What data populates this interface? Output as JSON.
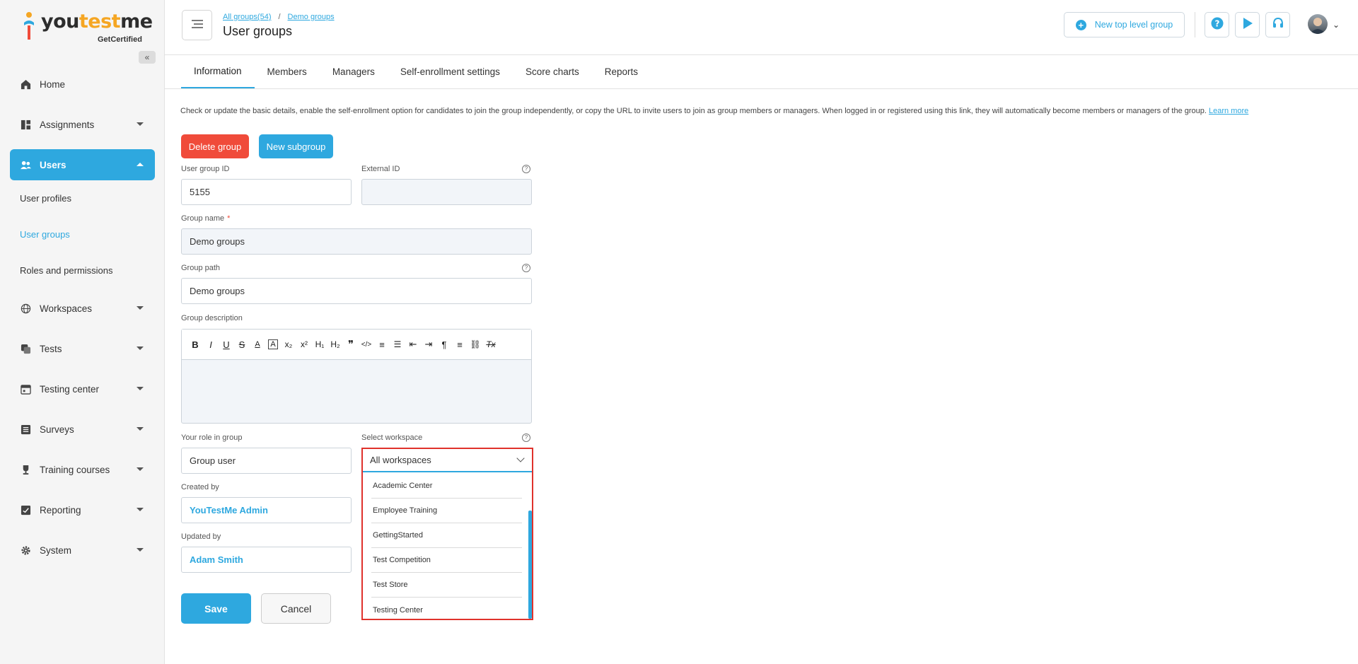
{
  "app": {
    "logo_you": "you",
    "logo_test": "test",
    "logo_me": "me",
    "logo_sub": "GetCertified"
  },
  "sidebar": {
    "collapse_icon": "double-chevron-left-icon",
    "items": [
      {
        "label": "Home",
        "icon": "home-icon"
      },
      {
        "label": "Assignments",
        "icon": "dashboard-icon"
      },
      {
        "label": "Users",
        "icon": "users-icon"
      },
      {
        "label": "Workspaces",
        "icon": "globe-icon"
      },
      {
        "label": "Tests",
        "icon": "tests-icon"
      },
      {
        "label": "Testing center",
        "icon": "calendar-icon"
      },
      {
        "label": "Surveys",
        "icon": "list-icon"
      },
      {
        "label": "Training courses",
        "icon": "trophy-icon"
      },
      {
        "label": "Reporting",
        "icon": "report-icon"
      },
      {
        "label": "System",
        "icon": "gear-icon"
      }
    ],
    "users_sub": [
      {
        "label": "User profiles"
      },
      {
        "label": "User groups"
      },
      {
        "label": "Roles and permissions"
      }
    ]
  },
  "header": {
    "breadcrumb_all": "All groups(54)",
    "breadcrumb_sep": "/",
    "breadcrumb_current": "Demo groups",
    "title": "User groups",
    "new_top_label": "New top level group"
  },
  "tabs": [
    {
      "label": "Information"
    },
    {
      "label": "Members"
    },
    {
      "label": "Managers"
    },
    {
      "label": "Self-enrollment settings"
    },
    {
      "label": "Score charts"
    },
    {
      "label": "Reports"
    }
  ],
  "info": {
    "text": "Check or update the basic details, enable the self-enrollment option for candidates to join the group independently, or copy the URL to invite users to join as group members or managers. When logged in or registered using this link, they will automatically become members or managers of the group.",
    "learn_more": "Learn more"
  },
  "actions": {
    "delete_label": "Delete group",
    "new_subgroup_label": "New subgroup"
  },
  "form": {
    "user_group_id_label": "User group ID",
    "user_group_id": "5155",
    "external_id_label": "External ID",
    "external_id": "",
    "group_name_label": "Group name",
    "required_mark": "*",
    "group_name": "Demo groups",
    "group_path_label": "Group path",
    "group_path": "Demo groups",
    "description_label": "Group description",
    "role_label": "Your role in group",
    "role": "Group user",
    "workspace_label": "Select workspace",
    "workspace_value": "All workspaces",
    "workspace_options": [
      {
        "label": "Academic Center"
      },
      {
        "label": "Employee Training"
      },
      {
        "label": "GettingStarted"
      },
      {
        "label": "Test Competition"
      },
      {
        "label": "Test Store"
      },
      {
        "label": "Testing Center"
      }
    ],
    "created_by_label": "Created by",
    "created_by": "YouTestMe Admin",
    "updated_by_label": "Updated by",
    "updated_by": "Adam Smith",
    "save_label": "Save",
    "cancel_label": "Cancel",
    "help_glyph": "?"
  },
  "editor_toolbar": [
    {
      "glyph": "B",
      "icon": "bold-icon"
    },
    {
      "glyph": "I",
      "icon": "italic-icon"
    },
    {
      "glyph": "U",
      "icon": "underline-icon"
    },
    {
      "glyph": "S",
      "icon": "strikethrough-icon"
    },
    {
      "glyph": "A",
      "icon": "font-color-icon"
    },
    {
      "glyph": "A",
      "icon": "highlight-icon"
    },
    {
      "glyph": "x₂",
      "icon": "subscript-icon"
    },
    {
      "glyph": "x²",
      "icon": "superscript-icon"
    },
    {
      "glyph": "H₁",
      "icon": "heading1-icon"
    },
    {
      "glyph": "H₂",
      "icon": "heading2-icon"
    },
    {
      "glyph": "❞",
      "icon": "blockquote-icon"
    },
    {
      "glyph": "</>",
      "icon": "code-icon"
    },
    {
      "glyph": "≡",
      "icon": "ordered-list-icon"
    },
    {
      "glyph": "☰",
      "icon": "bullet-list-icon"
    },
    {
      "glyph": "⇤",
      "icon": "outdent-icon"
    },
    {
      "glyph": "⇥",
      "icon": "indent-icon"
    },
    {
      "glyph": "¶",
      "icon": "text-direction-icon"
    },
    {
      "glyph": "≡",
      "icon": "align-icon"
    },
    {
      "glyph": "⛓",
      "icon": "link-icon"
    },
    {
      "glyph": "Tx",
      "icon": "clear-format-icon"
    }
  ],
  "colors": {
    "accent": "#2ea8df",
    "danger": "#f04b3a",
    "highlight_border": "#e0322c"
  }
}
